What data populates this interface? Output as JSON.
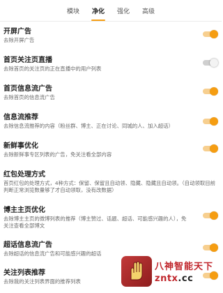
{
  "tabs": [
    {
      "label": "模块",
      "active": false
    },
    {
      "label": "净化",
      "active": true
    },
    {
      "label": "强化",
      "active": false
    },
    {
      "label": "高级",
      "active": false
    }
  ],
  "settings": [
    {
      "title": "开屏广告",
      "desc": "去除开屏广告",
      "enabled": true
    },
    {
      "title": "首页关注页直播",
      "desc": "去除首页的关注页的正在直播中的用户列表",
      "enabled": false
    },
    {
      "title": "首页信息流广告",
      "desc": "去除首页的信息流广告",
      "enabled": true
    },
    {
      "title": "信息流推荐",
      "desc": "去除信息流推荐的内容（粉丝群、博主、正在讨论、同城的人、加入超话）",
      "enabled": true
    },
    {
      "title": "新鲜事优化",
      "desc": "去除新鲜事专区列表的广告，免关注看全部内容",
      "enabled": true
    },
    {
      "title": "红包处理方式",
      "desc": "首页红包的处理方式，4种方式：保留、保留且自动领、隐藏、隐藏且自动领。（自动领取目前判断正常浏览数量够了才自动领取，没有改数据）",
      "enabled": null
    },
    {
      "title": "博主主页优化",
      "desc": "去除博主主页的微博列表的推荐（博主赞过、话题、超话、可能感兴趣的人），免关注查看全部博文",
      "enabled": true
    },
    {
      "title": "超话信息流广告",
      "desc": "去除超话的信息流广告和可能感兴趣的超话",
      "enabled": true
    },
    {
      "title": "关注列表推荐",
      "desc": "去除我的关注列表界面的推荐列表",
      "enabled": true
    }
  ],
  "watermark": {
    "name": "八神智能天下",
    "url_prefix": "zntx",
    "url_suffix": ".cc",
    "logo_icon": "hand-icon"
  },
  "colors": {
    "accent": "#f59d12",
    "accent_track": "#f7cf8f",
    "off_track": "#cfcfcf",
    "title_text": "#1f1f1f",
    "desc_text": "#6b6b6b",
    "watermark_red": "#c0262c"
  }
}
